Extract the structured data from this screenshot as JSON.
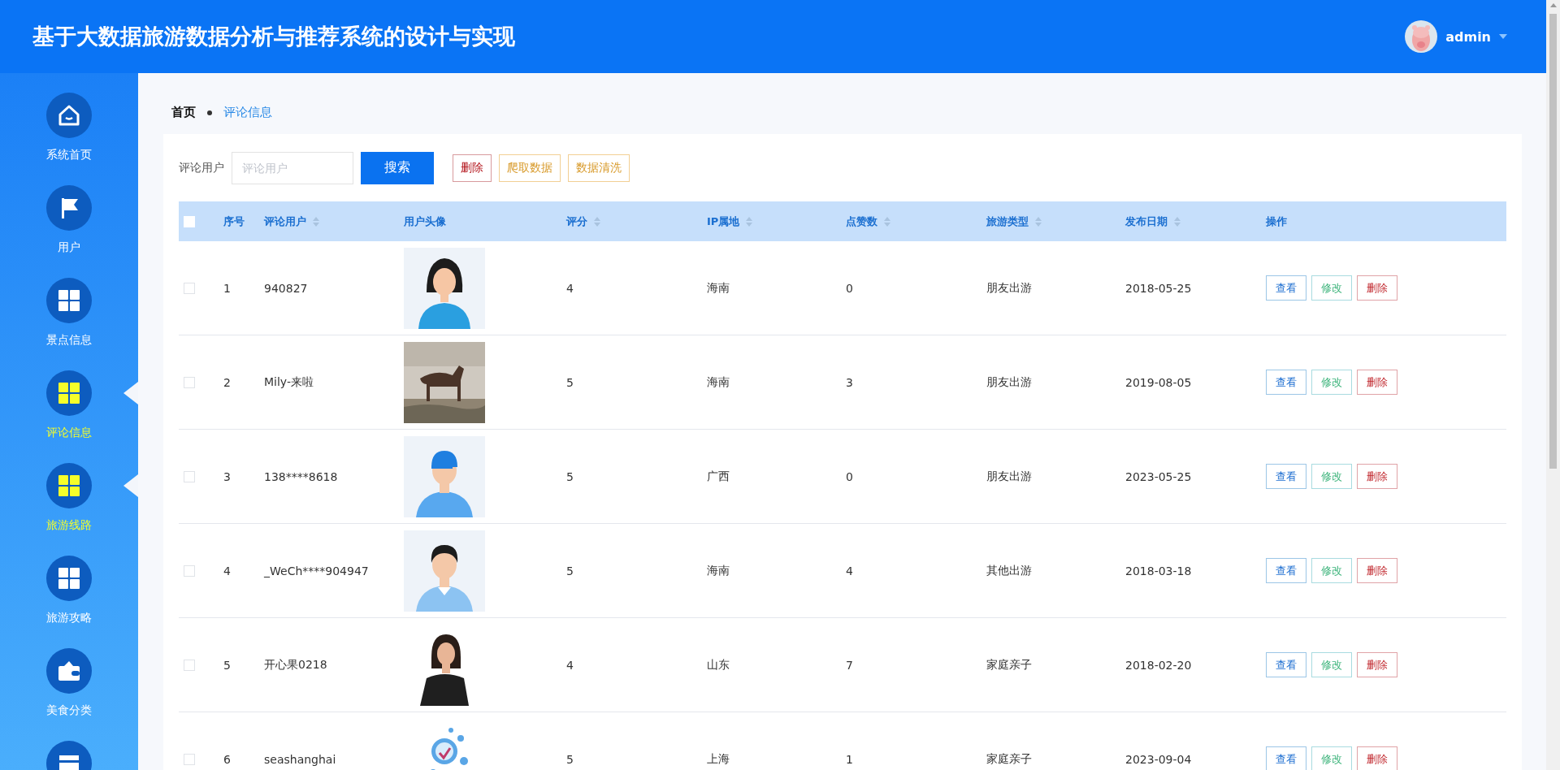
{
  "header": {
    "title": "基于大数据旅游数据分析与推荐系统的设计与实现",
    "user": {
      "name": "admin"
    }
  },
  "sidebar": {
    "items": [
      {
        "label": "系统首页",
        "kind": "home",
        "highlighted": false
      },
      {
        "label": "用户",
        "kind": "flag",
        "highlighted": false
      },
      {
        "label": "景点信息",
        "kind": "grid",
        "highlighted": false
      },
      {
        "label": "评论信息",
        "kind": "grid",
        "highlighted": true
      },
      {
        "label": "旅游线路",
        "kind": "grid",
        "highlighted": true
      },
      {
        "label": "旅游攻略",
        "kind": "grid",
        "highlighted": false
      },
      {
        "label": "美食分类",
        "kind": "wallet",
        "highlighted": false
      },
      {
        "kind": "card"
      }
    ]
  },
  "breadcrumb": [
    "首页",
    "评论信息"
  ],
  "filter": {
    "label": "评论用户",
    "placeholder": "评论用户"
  },
  "toolbar": [
    {
      "label": "搜索",
      "kind": "primary"
    },
    {
      "label": "删除",
      "kind": "danger"
    },
    {
      "label": "爬取数据",
      "kind": "warning"
    },
    {
      "label": "数据清洗",
      "kind": "warning"
    }
  ],
  "table": {
    "header_checkbox": {
      "checked": false
    },
    "columns": [
      {
        "label": "序号",
        "sortable": false
      },
      {
        "label": "评论用户",
        "sortable": true
      },
      {
        "label": "用户头像",
        "sortable": false
      },
      {
        "label": "评分",
        "sortable": true
      },
      {
        "label": "IP属地",
        "sortable": true
      },
      {
        "label": "点赞数",
        "sortable": true
      },
      {
        "label": "旅游类型",
        "sortable": true
      },
      {
        "label": "发布日期",
        "sortable": true
      },
      {
        "label": "操作",
        "sortable": false
      }
    ],
    "rows": [
      {
        "checked": false,
        "index": "1",
        "user": "940827",
        "avatar": {
          "kind": "woman"
        },
        "score": "4",
        "ip": "海南",
        "likes": "0",
        "type": "朋友出游",
        "date": "2018-05-25",
        "actions": [
          "查看",
          "修改",
          "删除"
        ]
      },
      {
        "checked": false,
        "index": "2",
        "user": "Mily-来啦",
        "avatar": {
          "kind": "picture"
        },
        "score": "5",
        "ip": "海南",
        "likes": "3",
        "type": "朋友出游",
        "date": "2019-08-05",
        "actions": [
          "查看",
          "修改",
          "删除"
        ]
      },
      {
        "checked": false,
        "index": "3",
        "user": "138****8618",
        "avatar": {
          "kind": "cap"
        },
        "score": "5",
        "ip": "广西",
        "likes": "0",
        "type": "朋友出游",
        "date": "2023-05-25",
        "actions": [
          "查看",
          "修改",
          "删除"
        ]
      },
      {
        "checked": false,
        "index": "4",
        "user": "_WeCh****904947",
        "avatar": {
          "kind": "man"
        },
        "score": "5",
        "ip": "海南",
        "likes": "4",
        "type": "其他出游",
        "date": "2018-03-18",
        "actions": [
          "查看",
          "修改",
          "删除"
        ]
      },
      {
        "checked": false,
        "index": "5",
        "user": "开心果0218",
        "avatar": {
          "kind": "portrait"
        },
        "score": "4",
        "ip": "山东",
        "likes": "7",
        "type": "家庭亲子",
        "date": "2018-02-20",
        "actions": [
          "查看",
          "修改",
          "删除"
        ]
      },
      {
        "checked": false,
        "index": "6",
        "user": "seashanghai",
        "avatar": {
          "kind": "bubble"
        },
        "score": "5",
        "ip": "上海",
        "likes": "1",
        "type": "家庭亲子",
        "date": "2023-09-04",
        "actions": [
          "查看",
          "修改",
          "删除"
        ]
      }
    ]
  }
}
